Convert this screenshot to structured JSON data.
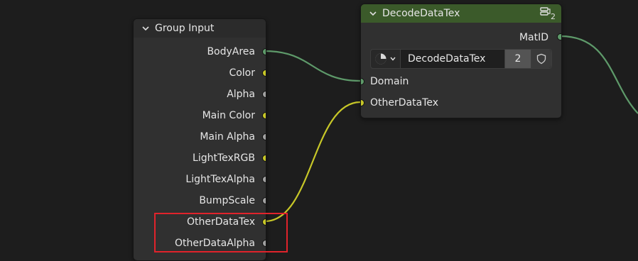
{
  "colors": {
    "background": "#1d1d1d",
    "node_body": "#303030",
    "group_header": "#2b2b2b",
    "decode_header": "#3b5a2a",
    "socket_green": "#5e9a6a",
    "socket_yellow": "#c7c728",
    "socket_grey": "#a1a1a1",
    "link_green": "#5e9a6a",
    "link_yellow": "#c7c728",
    "highlight": "#e0232b"
  },
  "group_input": {
    "title": "Group Input",
    "outputs": [
      {
        "label": "BodyArea",
        "type": "green"
      },
      {
        "label": "Color",
        "type": "yellow"
      },
      {
        "label": "Alpha",
        "type": "grey"
      },
      {
        "label": "Main Color",
        "type": "yellow"
      },
      {
        "label": "Main Alpha",
        "type": "grey"
      },
      {
        "label": "LightTexRGB",
        "type": "yellow"
      },
      {
        "label": "LightTexAlpha",
        "type": "grey"
      },
      {
        "label": "BumpScale",
        "type": "grey"
      },
      {
        "label": "OtherDataTex",
        "type": "yellow"
      },
      {
        "label": "OtherDataAlpha",
        "type": "grey"
      }
    ]
  },
  "decode_node": {
    "title": "DecodeDataTex",
    "user_count": "2",
    "output": {
      "label": "MatID",
      "type": "green"
    },
    "datablock": {
      "name": "DecodeDataTex",
      "users": "2"
    },
    "inputs": [
      {
        "label": "Domain",
        "type": "green"
      },
      {
        "label": "OtherDataTex",
        "type": "yellow"
      }
    ]
  }
}
